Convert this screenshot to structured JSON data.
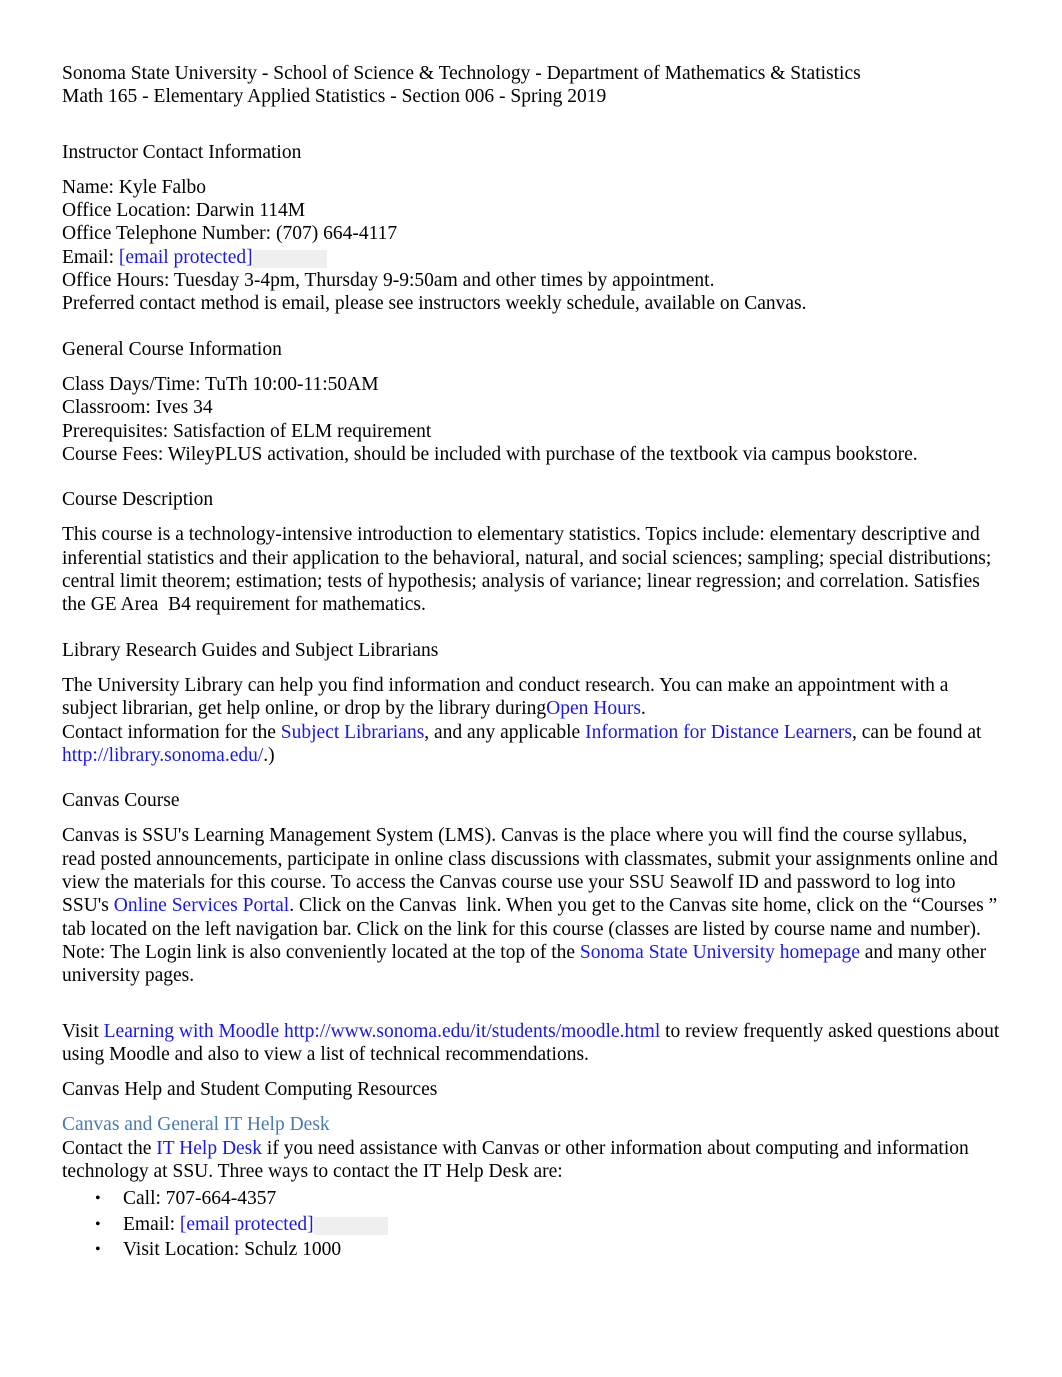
{
  "document": {
    "header": {
      "line1": "Sonoma State University - School of Science & Technology - Department of Mathematics & Statistics",
      "line2": "Math 165 - Elementary Applied Statistics - Section 006 - Spring 2019"
    },
    "sections": {
      "instructor": {
        "heading": "Instructor Contact Information",
        "name_line": "Name: Kyle Falbo",
        "office_location_line": "Office Location: Darwin 114M",
        "office_phone_line": "Office Telephone Number: (707) 664-4117",
        "email_label": "Email: ",
        "email_value": "[email protected]",
        "office_hours_line": "Office Hours: Tuesday 3-4pm, Thursday 9-9:50am and other times by appointment.",
        "preferred_contact_line": "Preferred contact method is email, please see instructors weekly schedule, available on Canvas."
      },
      "general_course": {
        "heading": "General Course Information",
        "class_days_line": "Class Days/Time: TuTh 10:00-11:50AM",
        "classroom_line": "Classroom: Ives 34",
        "prerequisites_line": "Prerequisites: Satisfaction of ELM requirement",
        "course_fees_line": "Course Fees: WileyPLUS activation, should be included with purchase of the textbook via campus bookstore."
      },
      "course_description": {
        "heading": "Course Description",
        "body": "This course is a technology-intensive introduction to elementary statistics. Topics include: elementary descriptive and inferential statistics and their application to the behavioral, natural, and social sciences; sampling; special distributions; central limit theorem; estimation; tests of hypothesis; analysis of variance; linear regression; and correlation. Satisfies the GE Area  B4 requirement for mathematics."
      },
      "library": {
        "heading": "Library Research Guides and Subject Librarians",
        "para1_before": "The University Library can help you find information and conduct research. You can make an appointment with a subject librarian, get help online, or drop by the library during",
        "link_open_hours": "Open Hours",
        "para1_after": ".",
        "para2_before": "Contact information for the ",
        "link_subject_librarians": "Subject Librarians",
        "para2_mid": ", and any applicable ",
        "link_distance_learners": "Information for Distance Learners",
        "para2_after": ", can be found at ",
        "link_library_url": "http://library.sonoma.edu/",
        "para2_end": ".)"
      },
      "canvas_course": {
        "heading": "Canvas Course",
        "body_before": "Canvas is SSU's Learning Management System (LMS). Canvas is the place where you will find the course syllabus, read posted announcements, participate in online class discussions with classmates, submit your assignments online and view the materials for this course. To access the Canvas course use your SSU Seawolf ID and password to log into SSU's ",
        "link_online_services": "Online Services Portal",
        "body_mid": ". Click on the Canvas  link. When you get to the Canvas site home, click on the “Courses ” tab located on the left navigation bar. Click on the link for this course (classes are listed by course name and number). Note: The Login link is also conveniently located at the top of the ",
        "link_ssu_homepage": "Sonoma State University homepage",
        "body_after": " and many other university pages."
      },
      "moodle": {
        "visit_label": "Visit ",
        "link_moodle": "Learning with Moodle http://www.sonoma.edu/it/students/moodle.html",
        "after": " to review frequently asked questions about using Moodle and also to view a list of technical recommendations."
      },
      "canvas_help": {
        "heading": "Canvas Help and Student Computing Resources",
        "link_help_desk_title": "Canvas and General IT Help Desk",
        "contact_before": "Contact the ",
        "link_it_help_desk": "IT Help Desk",
        "contact_after": " if you need assistance with Canvas or other information about computing and information technology at SSU. Three ways to contact the IT Help Desk are:",
        "bullets": [
          {
            "bullet": "•",
            "label": "Call: 707-664-4357",
            "link": null
          },
          {
            "bullet": "•",
            "label": "Email: ",
            "link": "[email protected]"
          },
          {
            "bullet": "•",
            "label": "Visit Location: Schulz 1000",
            "link": null
          }
        ]
      }
    }
  },
  "colors": {
    "link_blue": "#1818e8",
    "link_soft_blue": "#4a7ab0",
    "text_black": "#000000",
    "page_background": "#ffffff"
  }
}
